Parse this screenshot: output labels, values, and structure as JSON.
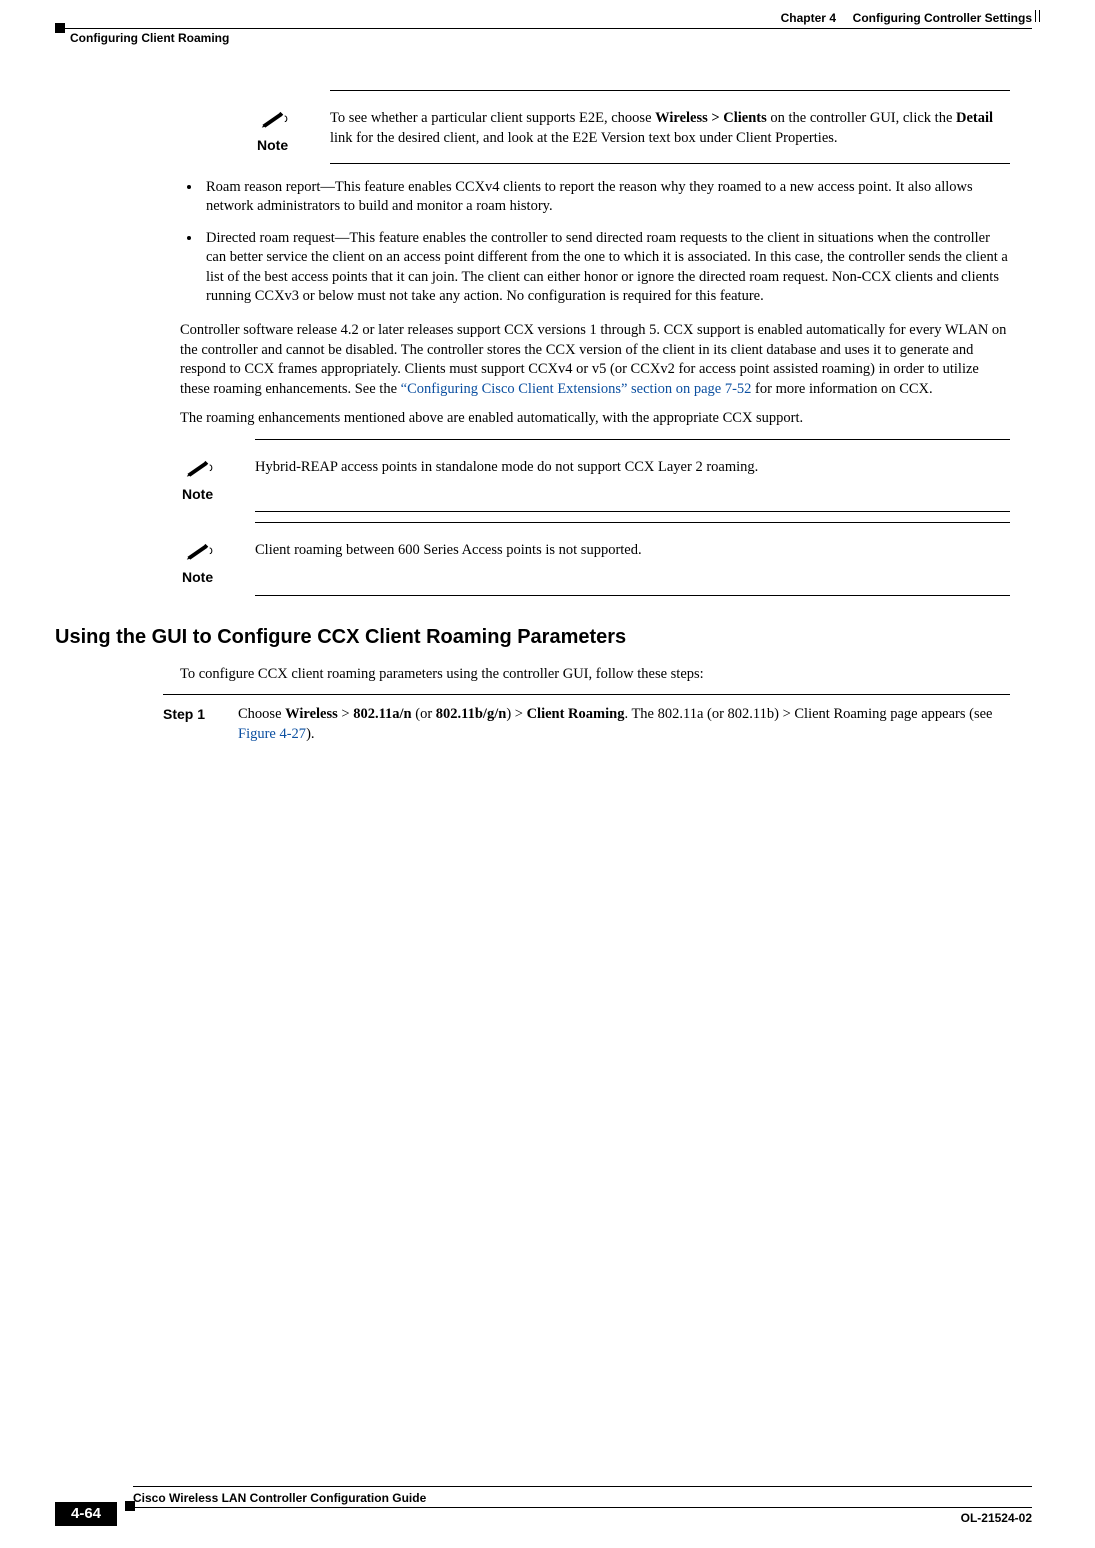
{
  "header": {
    "chapter_label": "Chapter 4",
    "chapter_title": "Configuring Controller Settings",
    "section": "Configuring Client Roaming"
  },
  "note1": {
    "label": "Note",
    "text_before_bold1": "To see whether a particular client supports E2E, choose ",
    "bold1": "Wireless > Clients",
    "text_mid1": " on the controller GUI, click the ",
    "bold2": "Detail",
    "text_after": " link for the desired client, and look at the E2E Version text box under Client Properties."
  },
  "bullets": [
    "Roam reason report—This feature enables CCXv4 clients to report the reason why they roamed to a new access point. It also allows network administrators to build and monitor a roam history.",
    "Directed roam request—This feature enables the controller to send directed roam requests to the client in situations when the controller can better service the client on an access point different from the one to which it is associated. In this case, the controller sends the client a list of the best access points that it can join. The client can either honor or ignore the directed roam request. Non-CCX clients and clients running CCXv3 or below must not take any action. No configuration is required for this feature."
  ],
  "para1_before_link": "Controller software release 4.2 or later releases support CCX versions 1 through 5. CCX support is enabled automatically for every WLAN on the controller and cannot be disabled. The controller stores the CCX version of the client in its client database and uses it to generate and respond to CCX frames appropriately. Clients must support CCXv4 or v5 (or CCXv2 for access point assisted roaming) in order to utilize these roaming enhancements. See the ",
  "para1_link": "“Configuring Cisco Client Extensions” section on page 7-52",
  "para1_after_link": " for more information on CCX.",
  "para2": "The roaming enhancements mentioned above are enabled automatically, with the appropriate CCX support.",
  "note2": {
    "label": "Note",
    "text": "Hybrid-REAP access points in standalone mode do not support CCX Layer 2 roaming."
  },
  "note3": {
    "label": "Note",
    "text": "Client roaming between 600 Series Access points is not supported."
  },
  "h2": "Using the GUI to Configure CCX Client Roaming Parameters",
  "intro": "To configure CCX client roaming parameters using the controller GUI, follow these steps:",
  "step1": {
    "label": "Step 1",
    "pre": "Choose ",
    "b1": "Wireless",
    "t1": " > ",
    "b2": "802.11a/n",
    "t2": " (or ",
    "b3": "802.11b/g/n",
    "t3": ") > ",
    "b4": "Client Roaming",
    "t4": ". The 802.11a (or 802.11b) > Client Roaming page appears (see ",
    "link": "Figure 4-27",
    "post": ")."
  },
  "footer": {
    "guide": "Cisco Wireless LAN Controller Configuration Guide",
    "docnum": "OL-21524-02",
    "pagenum": "4-64"
  }
}
